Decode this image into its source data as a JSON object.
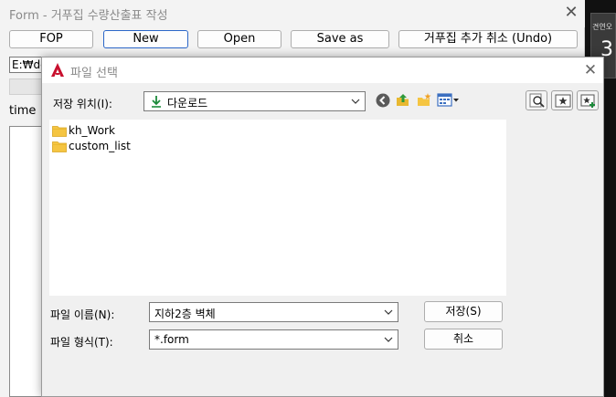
{
  "form": {
    "title": "Form - 거푸집 수량산출표 작성",
    "toolbar": {
      "fop": "FOP",
      "new": "New",
      "open": "Open",
      "save_as": "Save as",
      "undo": "거푸집 추가 취소 (Undo)"
    },
    "path_value": "E:₩dc",
    "time_label": "time |"
  },
  "background_app": {
    "thumb_text": "견연오",
    "digit": "3"
  },
  "dialog": {
    "title": "파일 선택",
    "location_label": "저장 위치(I):",
    "location_value": "다운로드",
    "files": [
      {
        "name": "kh_Work",
        "icon": "folder-icon"
      },
      {
        "name": "custom_list",
        "icon": "folder-icon"
      }
    ],
    "filename_label": "파일 이름(N):",
    "filename_value": "지하2층 벽체",
    "filetype_label": "파일 형식(T):",
    "filetype_value": "*.form",
    "save_button": "저장(S)",
    "cancel_button": "취소"
  },
  "colors": {
    "accent_border": "#2b66c8",
    "folder": "#f5c542",
    "download_arrow": "#1b8a3a",
    "logo_red": "#c8102e"
  }
}
